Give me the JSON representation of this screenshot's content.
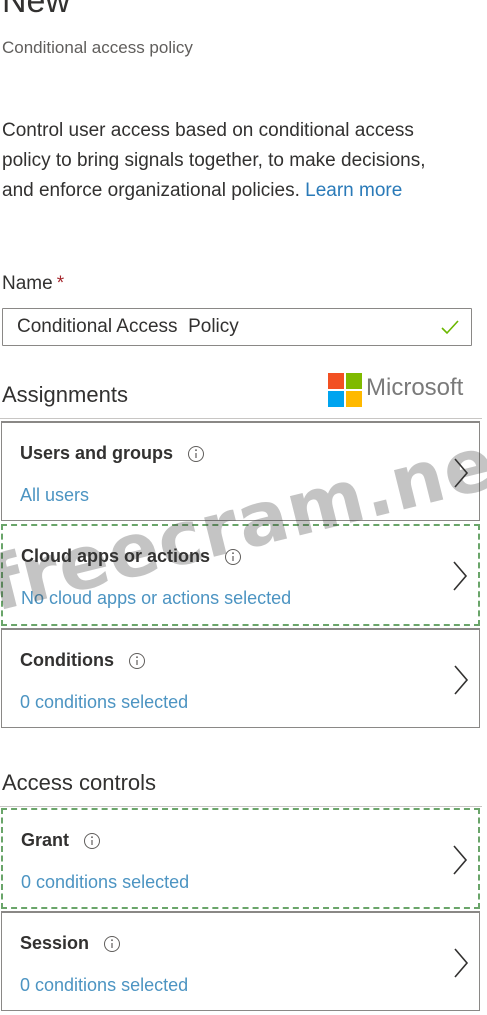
{
  "header": {
    "title": "New",
    "subtitle": "Conditional access policy"
  },
  "description": {
    "text": "Control user access based on conditional access policy to bring signals together, to make decisions, and enforce organizational policies.",
    "link": "Learn more"
  },
  "name_field": {
    "label": "Name",
    "required_marker": "*",
    "value": "Conditional Access  Policy",
    "valid": true
  },
  "assignments": {
    "heading": "Assignments",
    "items": [
      {
        "title": "Users and groups",
        "value": "All users"
      },
      {
        "title": "Cloud apps or actions",
        "value": "No cloud apps or actions selected"
      },
      {
        "title": "Conditions",
        "value": "0 conditions selected"
      }
    ]
  },
  "access_controls": {
    "heading": "Access controls",
    "items": [
      {
        "title": "Grant",
        "value": "0 conditions selected"
      },
      {
        "title": "Session",
        "value": "0 conditions selected"
      }
    ]
  },
  "watermark": {
    "logo_text": "Microsoft",
    "overlay_text": "freecram.net"
  },
  "colors": {
    "link": "#2a7ab8",
    "value_text": "#4c94c2",
    "required": "#a4262c",
    "valid_check": "#6bb700",
    "dashed_highlight": "#6aa56a"
  }
}
